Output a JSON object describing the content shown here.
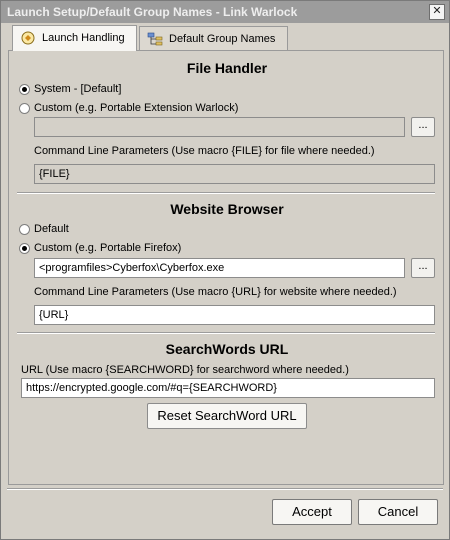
{
  "window": {
    "title": "Launch Setup/Default Group Names - Link Warlock",
    "close_glyph": "✕"
  },
  "tabs": [
    {
      "label": "Launch Handling",
      "icon": "launch-handling-icon",
      "active": true
    },
    {
      "label": "Default Group Names",
      "icon": "group-tree-icon",
      "active": false
    }
  ],
  "file_handler": {
    "title": "File Handler",
    "system_label": "System - [Default]",
    "custom_label": "Custom (e.g. Portable Extension Warlock)",
    "path_value": "",
    "browse_label": "...",
    "params_label": "Command Line Parameters (Use macro {FILE} for file where needed.)",
    "params_value": "{FILE}",
    "selected": "system"
  },
  "website_browser": {
    "title": "Website Browser",
    "default_label": "Default",
    "custom_label": "Custom (e.g. Portable Firefox)",
    "path_value": "<programfiles>Cyberfox\\Cyberfox.exe",
    "browse_label": "...",
    "params_label": "Command Line Parameters (Use macro {URL} for website where needed.)",
    "params_value": "{URL}",
    "selected": "custom"
  },
  "searchwords": {
    "title": "SearchWords URL",
    "url_label": "URL (Use macro {SEARCHWORD} for searchword where needed.)",
    "url_value": "https://encrypted.google.com/#q={SEARCHWORD}",
    "reset_label": "Reset SearchWord URL"
  },
  "dialog": {
    "accept_label": "Accept",
    "cancel_label": "Cancel"
  },
  "colors": {
    "window_bg": "#d4d0c8",
    "titlebar": "#9c9c9c",
    "title_text": "#eeeeee"
  }
}
